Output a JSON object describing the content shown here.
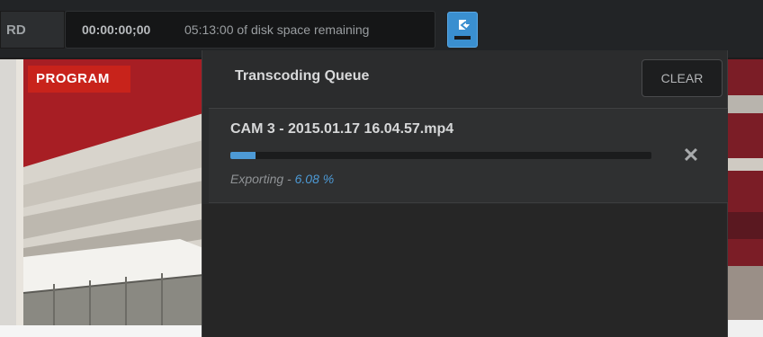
{
  "topbar": {
    "record_label": "RD",
    "timecode": "00:00:00;00",
    "disk_space": "05:13:00 of disk space remaining",
    "transcode_icon": "transcode-queue-icon",
    "accent_color": "#3a8fd0"
  },
  "program": {
    "badge_label": "PROGRAM",
    "badge_color": "#c8231b"
  },
  "transcoding": {
    "title": "Transcoding Queue",
    "clear_label": "CLEAR",
    "items": [
      {
        "file_name": "CAM 3 - 2015.01.17 16.04.57.mp4",
        "status": "Exporting",
        "separator": "-",
        "percent_text": "6.08 %",
        "progress_percent": 6.08,
        "remove_icon": "close-icon",
        "remove_glyph": "✕"
      }
    ]
  }
}
